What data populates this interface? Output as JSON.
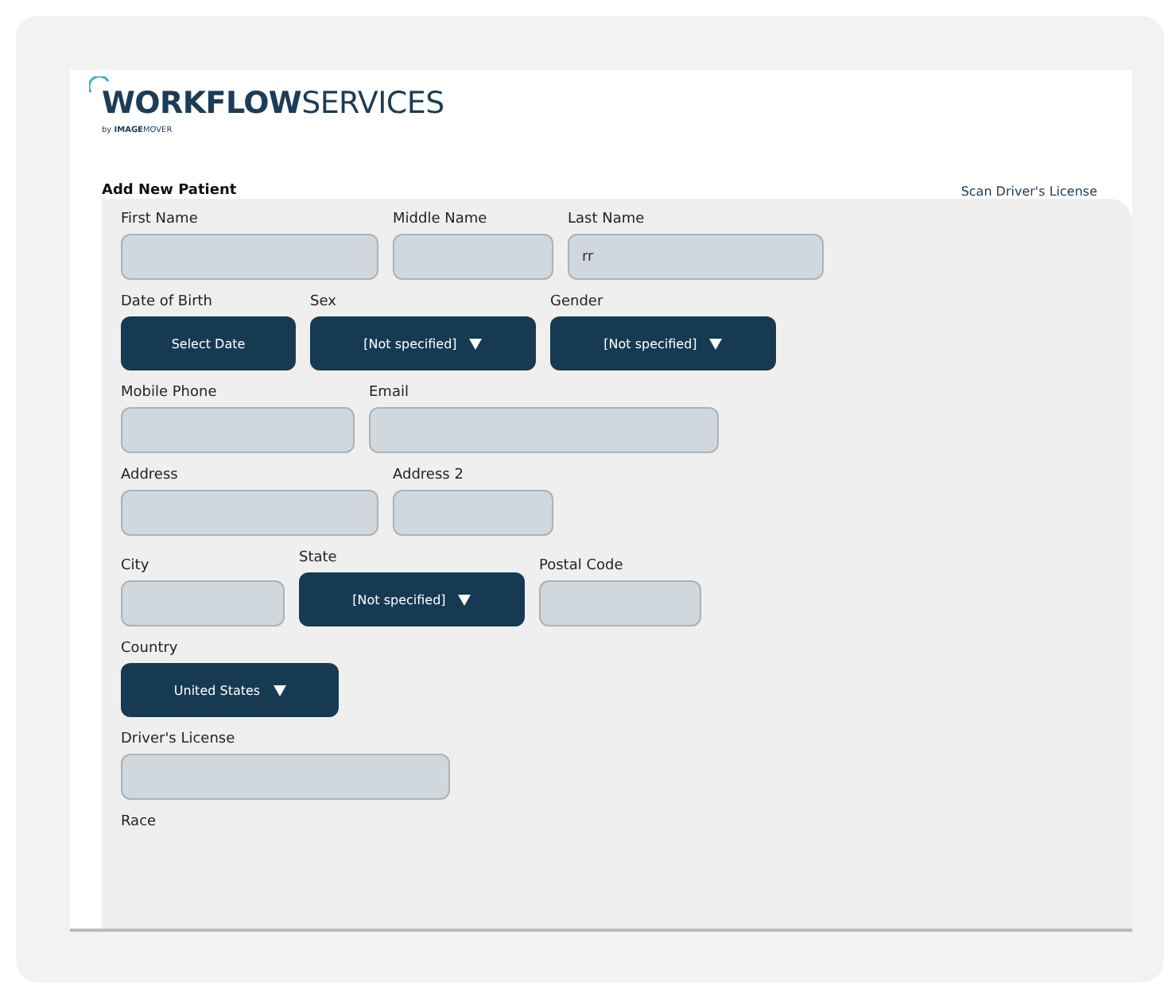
{
  "logo": {
    "brand_bold": "WORKFLOW",
    "brand_light": "SERVICES",
    "byline_prefix": "by",
    "byline_bold": "IMAGE",
    "byline_light": "MOVER"
  },
  "form": {
    "title": "Add New Patient",
    "scan_link": "Scan Driver's License",
    "rows": [
      [
        {
          "label": "First Name",
          "kind": "text"
        },
        {
          "label": "Middle Name",
          "kind": "text"
        },
        {
          "label": "Last Name",
          "kind": "text",
          "value": "rr"
        }
      ],
      [
        {
          "label": "Date of Birth",
          "kind": "button",
          "value": "Select Date"
        },
        {
          "label": "Sex",
          "kind": "select",
          "value": "[Not specified]"
        },
        {
          "label": "Gender",
          "kind": "select",
          "value": "[Not specified]"
        }
      ],
      [
        {
          "label": "Mobile Phone",
          "kind": "text"
        },
        {
          "label": "Email",
          "kind": "text"
        }
      ],
      [
        {
          "label": "Address",
          "kind": "text"
        },
        {
          "label": "Address 2",
          "kind": "text"
        }
      ],
      [
        {
          "label": "City",
          "kind": "text"
        },
        {
          "label": "State",
          "kind": "select",
          "value": "[Not specified]"
        },
        {
          "label": "Postal Code",
          "kind": "text"
        }
      ],
      [
        {
          "label": "Country",
          "kind": "select",
          "value": "United States"
        }
      ],
      [
        {
          "label": "Driver's License",
          "kind": "text"
        }
      ],
      [
        {
          "label": "Race",
          "kind": "label"
        }
      ]
    ]
  }
}
